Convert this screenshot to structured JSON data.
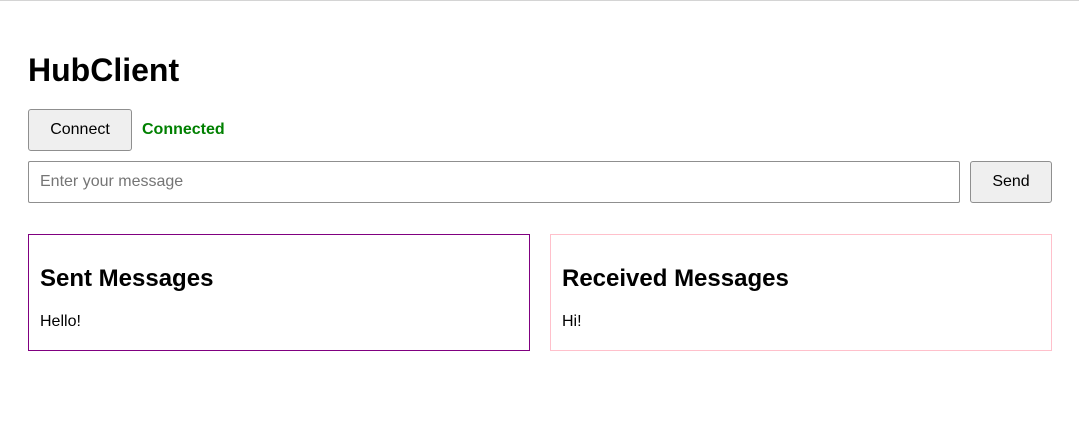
{
  "app": {
    "title": "HubClient"
  },
  "connection": {
    "connect_label": "Connect",
    "status_text": "Connected",
    "status_color": "#008000"
  },
  "composer": {
    "input_value": "",
    "input_placeholder": "Enter your message",
    "send_label": "Send"
  },
  "panels": {
    "sent": {
      "heading": "Sent Messages",
      "border_color": "#800080",
      "messages": [
        "Hello!"
      ]
    },
    "received": {
      "heading": "Received Messages",
      "border_color": "#ffc0cb",
      "messages": [
        "Hi!"
      ]
    }
  },
  "colors": {
    "background": "#ffffff",
    "text": "#000000",
    "button_background": "#efefef",
    "border": "#8f8f8f"
  }
}
